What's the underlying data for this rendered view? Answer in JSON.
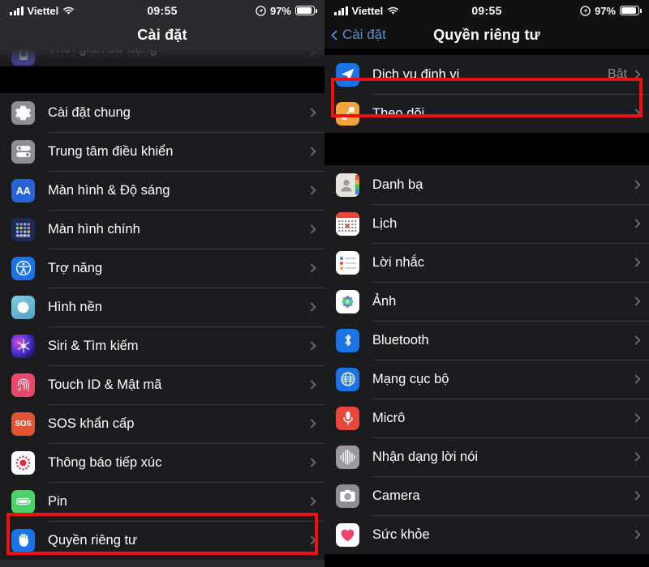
{
  "status_bar": {
    "carrier": "Viettel",
    "time": "09:55",
    "battery_percent": "97%",
    "signal_icon": "cellular-bars-icon",
    "wifi_icon": "wifi-icon",
    "location_icon": "location-arrow-indicator-icon",
    "battery_icon": "battery-icon"
  },
  "left_screen": {
    "title": "Cài đặt",
    "partial_row": {
      "label": "Thời gian sử dụng",
      "icon": "screen-time-icon"
    },
    "items": [
      {
        "label": "Cài đặt chung",
        "icon": "gear-icon"
      },
      {
        "label": "Trung tâm điều khiển",
        "icon": "control-center-icon"
      },
      {
        "label": "Màn hình & Độ sáng",
        "icon": "display-brightness-icon"
      },
      {
        "label": "Màn hình chính",
        "icon": "home-screen-icon"
      },
      {
        "label": "Trợ năng",
        "icon": "accessibility-icon"
      },
      {
        "label": "Hình nền",
        "icon": "wallpaper-icon"
      },
      {
        "label": "Siri & Tìm kiếm",
        "icon": "siri-icon"
      },
      {
        "label": "Touch ID & Mật mã",
        "icon": "touch-id-icon"
      },
      {
        "label": "SOS khẩn cấp",
        "icon": "sos-icon"
      },
      {
        "label": "Thông báo tiếp xúc",
        "icon": "exposure-notification-icon"
      },
      {
        "label": "Pin",
        "icon": "battery-icon"
      },
      {
        "label": "Quyền riêng tư",
        "icon": "privacy-hand-icon",
        "highlighted": true
      }
    ]
  },
  "right_screen": {
    "back_label": "Cài đặt",
    "title": "Quyền riêng tư",
    "section_1": [
      {
        "label": "Dịch vụ định vị",
        "value": "Bật",
        "icon": "location-arrow-icon",
        "highlighted": true
      },
      {
        "label": "Theo dõi",
        "icon": "tracking-icon"
      }
    ],
    "section_2": [
      {
        "label": "Danh bạ",
        "icon": "contacts-icon"
      },
      {
        "label": "Lịch",
        "icon": "calendar-icon"
      },
      {
        "label": "Lời nhắc",
        "icon": "reminders-icon"
      },
      {
        "label": "Ảnh",
        "icon": "photos-icon"
      },
      {
        "label": "Bluetooth",
        "icon": "bluetooth-icon"
      },
      {
        "label": "Mạng cục bộ",
        "icon": "local-network-icon"
      },
      {
        "label": "Micrô",
        "icon": "microphone-icon"
      },
      {
        "label": "Nhận dạng lời nói",
        "icon": "speech-recognition-icon"
      },
      {
        "label": "Camera",
        "icon": "camera-icon"
      },
      {
        "label": "Sức khỏe",
        "icon": "health-icon"
      }
    ]
  },
  "colors": {
    "highlight_box": "#ee1111",
    "accent_blue": "#5a8ed0",
    "row_bg": "#1c1c1e",
    "value_gray": "#8e8e93"
  }
}
